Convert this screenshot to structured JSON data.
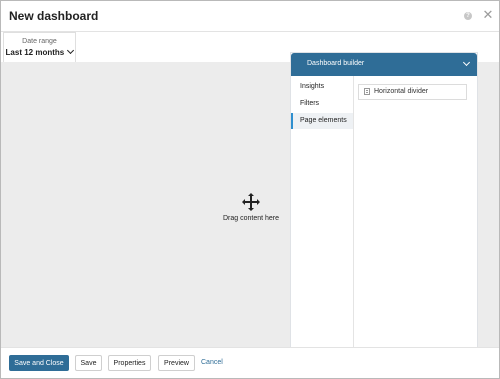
{
  "window": {
    "title": "New dashboard"
  },
  "date_range": {
    "label": "Date range",
    "value": "Last 12 months"
  },
  "canvas": {
    "drag_text": "Drag content here"
  },
  "builder": {
    "title": "Dashboard builder",
    "tabs": [
      {
        "label": "Insights"
      },
      {
        "label": "Filters"
      },
      {
        "label": "Page elements",
        "active": true
      }
    ],
    "elements": [
      {
        "label": "Horizontal divider",
        "icon": "divider-icon"
      }
    ]
  },
  "footer": {
    "save_and_close": "Save and Close",
    "save": "Save",
    "properties": "Properties",
    "preview": "Preview",
    "cancel": "Cancel"
  },
  "colors": {
    "accent": "#2f6d97",
    "canvas": "#ececec",
    "tab_marker": "#2f8fcf"
  }
}
